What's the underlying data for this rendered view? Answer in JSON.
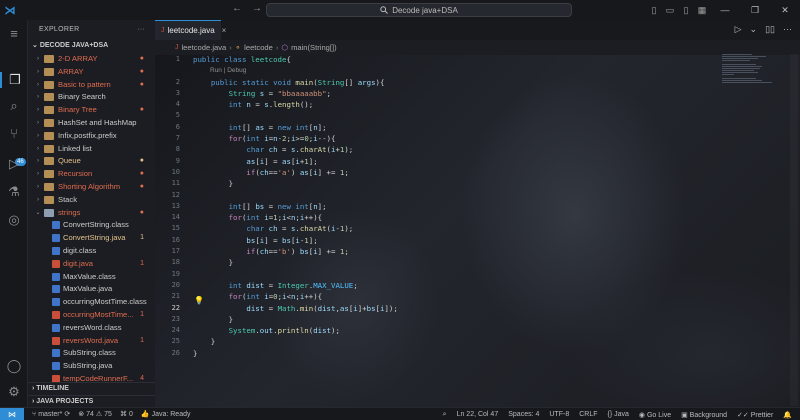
{
  "titlebar": {
    "search_text": "Decode java+DSA",
    "nav_back": "←",
    "nav_forward": "→",
    "win_minimize": "—",
    "win_restore": "❐",
    "win_close": "✕"
  },
  "explorer": {
    "title": "EXPLORER",
    "more": "···",
    "root": "DECODE JAVA+DSA",
    "items": [
      {
        "label": "2-D ARRAY",
        "type": "folder",
        "color": "#e06c50",
        "mark": "●"
      },
      {
        "label": "ARRAY",
        "type": "folder",
        "color": "#e06c50",
        "mark": "●"
      },
      {
        "label": "Basic to pattern",
        "type": "folder",
        "color": "#e06c50",
        "mark": "●"
      },
      {
        "label": "Binary Search",
        "type": "folder",
        "color": "#cccccc",
        "mark": ""
      },
      {
        "label": "Binary Tree",
        "type": "folder",
        "color": "#e06c50",
        "mark": "●"
      },
      {
        "label": "HashSet and HashMap",
        "type": "folder",
        "color": "#cccccc",
        "mark": ""
      },
      {
        "label": "Infix,postfix,prefix",
        "type": "folder",
        "color": "#cccccc",
        "mark": ""
      },
      {
        "label": "Linked list",
        "type": "folder",
        "color": "#cccccc",
        "mark": ""
      },
      {
        "label": "Queue",
        "type": "folder",
        "color": "#e2c08d",
        "mark": "●"
      },
      {
        "label": "Recursion",
        "type": "folder",
        "color": "#e06c50",
        "mark": "●"
      },
      {
        "label": "Shorting Algorithm",
        "type": "folder",
        "color": "#e06c50",
        "mark": "●"
      },
      {
        "label": "Stack",
        "type": "folder",
        "color": "#cccccc",
        "mark": ""
      },
      {
        "label": "strings",
        "type": "folder-open",
        "color": "#e06c50",
        "mark": "●"
      },
      {
        "label": "ConvertString.class",
        "type": "file",
        "color": "#cccccc",
        "mark": ""
      },
      {
        "label": "ConvertString.java",
        "type": "file",
        "color": "#e2c08d",
        "mark": "1"
      },
      {
        "label": "digit.class",
        "type": "file",
        "color": "#cccccc",
        "mark": ""
      },
      {
        "label": "digit.java",
        "type": "file-err",
        "color": "#e06c50",
        "mark": "1"
      },
      {
        "label": "MaxValue.class",
        "type": "file",
        "color": "#cccccc",
        "mark": ""
      },
      {
        "label": "MaxValue.java",
        "type": "file",
        "color": "#cccccc",
        "mark": ""
      },
      {
        "label": "occurringMostTime.class",
        "type": "file",
        "color": "#cccccc",
        "mark": ""
      },
      {
        "label": "occurringMostTime...",
        "type": "file-err",
        "color": "#e06c50",
        "mark": "1"
      },
      {
        "label": "reversWord.class",
        "type": "file",
        "color": "#cccccc",
        "mark": ""
      },
      {
        "label": "reversWord.java",
        "type": "file-err",
        "color": "#e06c50",
        "mark": "1"
      },
      {
        "label": "SubString.class",
        "type": "file",
        "color": "#cccccc",
        "mark": ""
      },
      {
        "label": "SubString.java",
        "type": "file",
        "color": "#cccccc",
        "mark": ""
      },
      {
        "label": "tempCodeRunnerF...",
        "type": "file-err",
        "color": "#e06c50",
        "mark": "4"
      }
    ],
    "sections": {
      "timeline": "TIMELINE",
      "java_projects": "JAVA PROJECTS"
    }
  },
  "editor": {
    "tab_label": "leetcode.java",
    "tab_icon": "J",
    "tab_close": "×",
    "breadcrumb": {
      "file": "leetcode.java",
      "class": "leetcode",
      "method": "main(String[])"
    },
    "codelens": "Run | Debug",
    "line_numbers": [
      "1",
      "2",
      "3",
      "4",
      "5",
      "6",
      "7",
      "8",
      "9",
      "10",
      "11",
      "12",
      "13",
      "14",
      "15",
      "16",
      "17",
      "18",
      "19",
      "20",
      "21",
      "22",
      "23",
      "24",
      "25",
      "26"
    ],
    "current_line": "22"
  },
  "statusbar": {
    "branch": "master*",
    "errors": "74",
    "warnings": "75",
    "ports": "0",
    "java_status": "Java: Ready",
    "position": "Ln 22, Col 47",
    "spaces": "Spaces: 4",
    "encoding": "UTF-8",
    "eol": "CRLF",
    "language": "Java",
    "go_live": "Go Live",
    "background": "Background",
    "prettier": "Prettier"
  },
  "colors": {
    "accent": "#2f8dd6",
    "error_folder": "#e06c50",
    "modified": "#e2c08d"
  }
}
